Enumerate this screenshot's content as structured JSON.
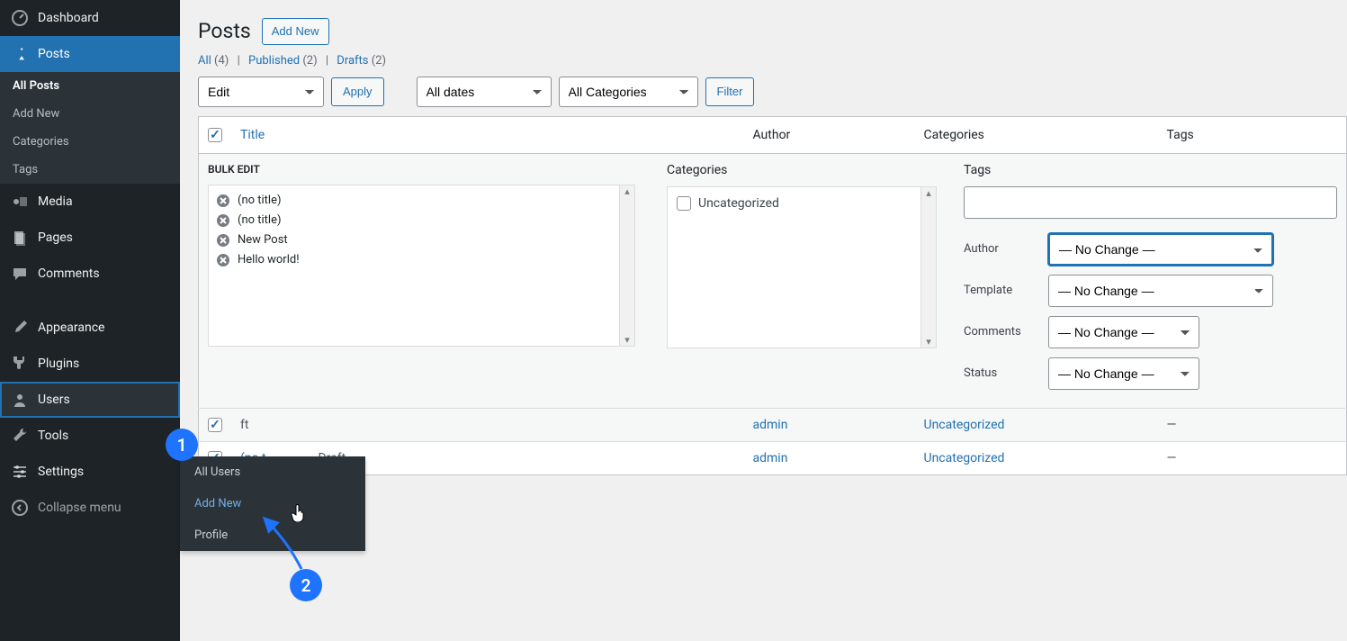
{
  "sidebar": {
    "dashboard": "Dashboard",
    "posts": "Posts",
    "sub": {
      "all": "All Posts",
      "addnew": "Add New",
      "categories": "Categories",
      "tags": "Tags"
    },
    "media": "Media",
    "pages": "Pages",
    "comments": "Comments",
    "appearance": "Appearance",
    "plugins": "Plugins",
    "users": "Users",
    "tools": "Tools",
    "settings": "Settings",
    "collapse": "Collapse menu"
  },
  "flyout": {
    "all": "All Users",
    "addnew": "Add New",
    "profile": "Profile"
  },
  "callouts": {
    "one": "1",
    "two": "2"
  },
  "page": {
    "title": "Posts",
    "add_new": "Add New",
    "filter_all": "All",
    "filter_all_count": "(4)",
    "filter_pub": "Published",
    "filter_pub_count": "(2)",
    "filter_drafts": "Drafts",
    "filter_drafts_count": "(2)",
    "bulk_action": "Edit",
    "apply": "Apply",
    "all_dates": "All dates",
    "all_cats": "All Categories",
    "filter_btn": "Filter"
  },
  "columns": {
    "title": "Title",
    "author": "Author",
    "categories": "Categories",
    "tags": "Tags"
  },
  "bulk": {
    "label": "BULK EDIT",
    "cats_label": "Categories",
    "tags_label": "Tags",
    "items": [
      "(no title)",
      "(no title)",
      "New Post",
      "Hello world!"
    ],
    "cat_uncategorized": "Uncategorized",
    "author_label": "Author",
    "template_label": "Template",
    "comments_label": "Comments",
    "status_label": "Status",
    "nochange": "— No Change —"
  },
  "rows": [
    {
      "title_partial": "ft",
      "author": "admin",
      "category": "Uncategorized",
      "tag": "—"
    },
    {
      "title_prefix": "(no t",
      "title_suffix": "— Draft",
      "author": "admin",
      "category": "Uncategorized",
      "tag": "—"
    }
  ]
}
